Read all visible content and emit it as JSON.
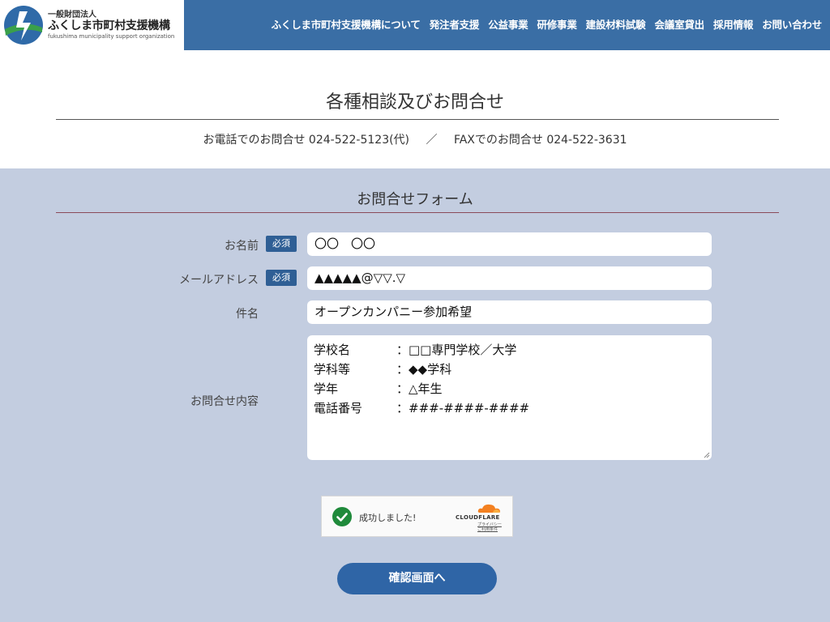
{
  "header": {
    "logo_top": "一般財団法人",
    "logo_main": "ふくしま市町村支援機構",
    "logo_en": "fukushima municipality support organization",
    "nav": [
      "ふくしま市町村支援機構について",
      "発注者支援",
      "公益事業",
      "研修事業",
      "建設材料試験",
      "会議室貸出",
      "採用情報",
      "お問い合わせ"
    ]
  },
  "page": {
    "title": "各種相談及びお問合せ",
    "tel_label": "お電話でのお問合せ",
    "tel_number": "024-522-5123(代)",
    "separator": "／",
    "fax_label": "FAXでのお問合せ",
    "fax_number": "024-522-3631"
  },
  "form": {
    "title": "お問合せフォーム",
    "required_badge": "必須",
    "name_label": "お名前",
    "name_value": "〇〇　〇〇",
    "email_label": "メールアドレス",
    "email_value": "▲▲▲▲▲@▽▽.▽",
    "subject_label": "件名",
    "subject_value": "オープンカンパニー参加希望",
    "message_label": "お問合せ内容",
    "message_lines": [
      {
        "key": "学校名",
        "value": "：□□専門学校／大学"
      },
      {
        "key": "学科等",
        "value": "：◆◆学科"
      },
      {
        "key": "学年",
        "value": "：△年生"
      },
      {
        "key": "電話番号",
        "value": "：###-####-####"
      }
    ]
  },
  "captcha": {
    "status": "成功しました!",
    "brand": "CLOUDFLARE",
    "privacy": "プライバシー",
    "terms": "ご利用条件"
  },
  "confirm_button": "確認画面へ",
  "colors": {
    "header_bg": "#3a6ea5",
    "form_bg": "#c3cde0",
    "badge": "#2f5f95",
    "button": "#2f65a6"
  }
}
